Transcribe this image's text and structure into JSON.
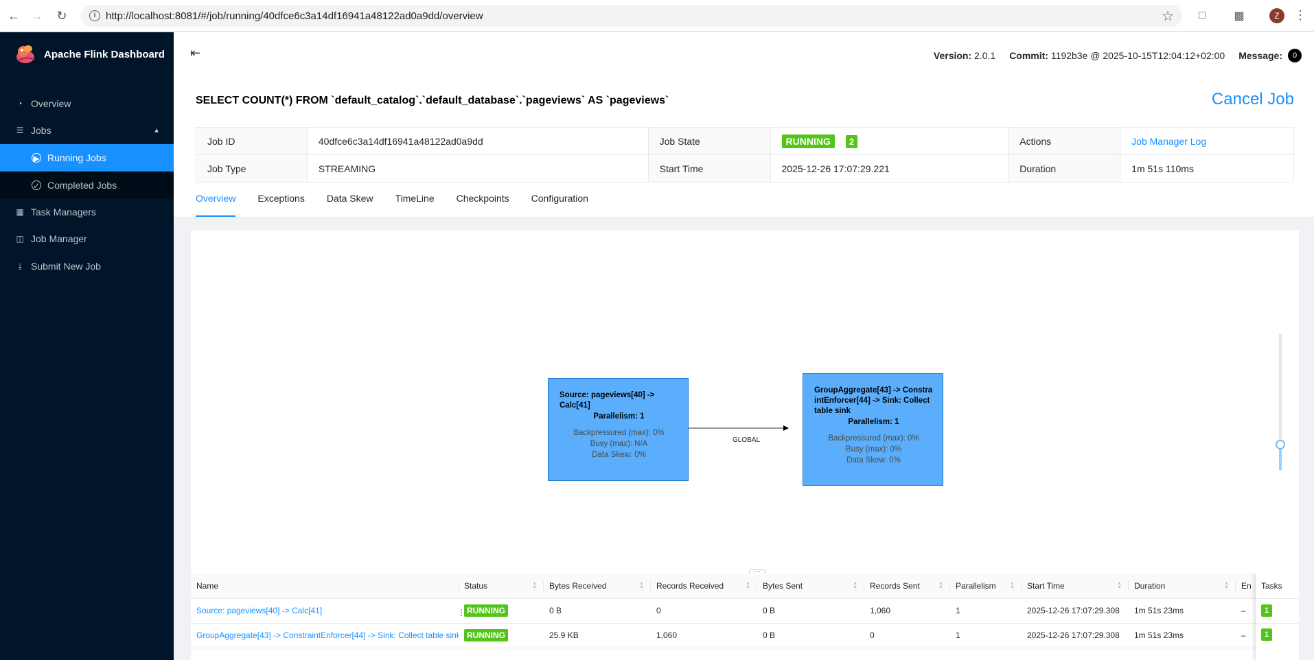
{
  "browser": {
    "url": "http://localhost:8081/#/job/running/40dfce6c3a14df16941a48122ad0a9dd/overview",
    "profile_initial": "Z"
  },
  "sidebar": {
    "title": "Apache Flink Dashboard",
    "items": [
      {
        "label": "Overview",
        "icon": "dashboard-icon"
      },
      {
        "label": "Jobs",
        "icon": "list-icon"
      },
      {
        "label": "Running Jobs",
        "icon": "play-circle-icon"
      },
      {
        "label": "Completed Jobs",
        "icon": "check-circle-icon"
      },
      {
        "label": "Task Managers",
        "icon": "schedule-icon"
      },
      {
        "label": "Job Manager",
        "icon": "cluster-icon"
      },
      {
        "label": "Submit New Job",
        "icon": "upload-icon"
      }
    ]
  },
  "header": {
    "version_label": "Version:",
    "version": "2.0.1",
    "commit_label": "Commit:",
    "commit": "1192b3e @ 2025-10-15T12:04:12+02:00",
    "message_label": "Message:",
    "message_count": "0"
  },
  "job": {
    "title": "SELECT COUNT(*) FROM `default_catalog`.`default_database`.`pageviews` AS `pageviews`",
    "cancel_label": "Cancel Job",
    "id_label": "Job ID",
    "id": "40dfce6c3a14df16941a48122ad0a9dd",
    "state_label": "Job State",
    "state": "RUNNING",
    "state_count": "2",
    "actions_label": "Actions",
    "actions_link": "Job Manager Log",
    "type_label": "Job Type",
    "type": "STREAMING",
    "start_label": "Start Time",
    "start": "2025-12-26 17:07:29.221",
    "duration_label": "Duration",
    "duration": "1m 51s 110ms"
  },
  "tabs": [
    "Overview",
    "Exceptions",
    "Data Skew",
    "TimeLine",
    "Checkpoints",
    "Configuration"
  ],
  "graph": {
    "nodes": [
      {
        "title": "Source: pageviews[40] -> Calc[41]",
        "parallelism": "Parallelism: 1",
        "backpressure": "Backpressured (max): 0%",
        "busy": "Busy (max): N/A",
        "skew": "Data Skew: 0%"
      },
      {
        "title": "GroupAggregate[43] -> ConstraintEnforcer[44] -> Sink: Collect table sink",
        "parallelism": "Parallelism: 1",
        "backpressure": "Backpressured (max): 0%",
        "busy": "Busy (max): 0%",
        "skew": "Data Skew: 0%"
      }
    ],
    "edge_label": "GLOBAL"
  },
  "vertices": {
    "columns": [
      "Name",
      "Status",
      "Bytes Received",
      "Records Received",
      "Bytes Sent",
      "Records Sent",
      "Parallelism",
      "Start Time",
      "Duration",
      "En",
      "Tasks"
    ],
    "rows": [
      {
        "name": "Source: pageviews[40] -> Calc[41]",
        "status": "RUNNING",
        "bytes_received": "0 B",
        "records_received": "0",
        "bytes_sent": "0 B",
        "records_sent": "1,060",
        "parallelism": "1",
        "start_time": "2025-12-26 17:07:29.308",
        "duration": "1m 51s 23ms",
        "end": "–",
        "tasks": "1"
      },
      {
        "name": "GroupAggregate[43] -> ConstraintEnforcer[44] -> Sink: Collect table sink",
        "status": "RUNNING",
        "bytes_received": "25.9 KB",
        "records_received": "1,060",
        "bytes_sent": "0 B",
        "records_sent": "0",
        "parallelism": "1",
        "start_time": "2025-12-26 17:07:29.308",
        "duration": "1m 51s 23ms",
        "end": "–",
        "tasks": "1"
      }
    ]
  },
  "colors": {
    "sidebar_bg": "#001529",
    "accent": "#1890ff",
    "running": "#52c41a",
    "node_fill": "#5aaefc"
  }
}
